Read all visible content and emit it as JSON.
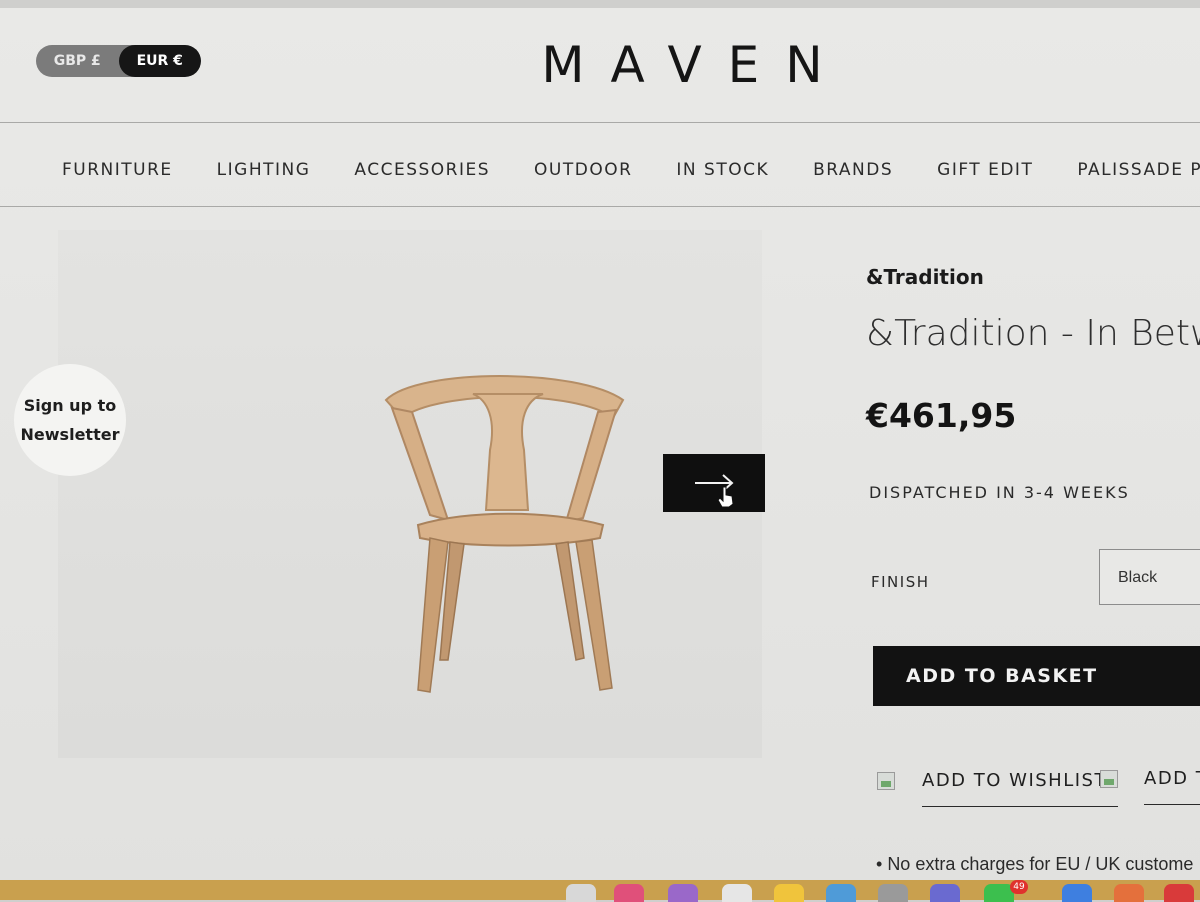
{
  "header": {
    "currency_options": [
      "GBP £",
      "EUR €"
    ],
    "active_currency": "EUR €",
    "logo": "MAVEN"
  },
  "nav": {
    "items": [
      "FURNITURE",
      "LIGHTING",
      "ACCESSORIES",
      "OUTDOOR",
      "IN STOCK",
      "BRANDS",
      "GIFT EDIT",
      "PALISSADE PRO"
    ]
  },
  "newsletter": {
    "line1": "Sign up to",
    "line2": "Newsletter"
  },
  "product": {
    "brand": "&Tradition",
    "title": "&Tradition - In Betw",
    "price": "€461,95",
    "dispatch": "DISPATCHED IN 3-4 WEEKS",
    "finish_label": "FINISH",
    "finish_value": "Black",
    "add_to_basket": "ADD TO BASKET",
    "add_to_wishlist": "ADD TO WISHLIST",
    "add_to_second": "ADD T",
    "note": "No extra charges for EU / UK custome"
  },
  "icons": {
    "next": "arrow-right-icon",
    "cursor": "hand-pointer-icon",
    "broken_image": "broken-image-icon"
  },
  "dock": {
    "badge_count": "49"
  }
}
